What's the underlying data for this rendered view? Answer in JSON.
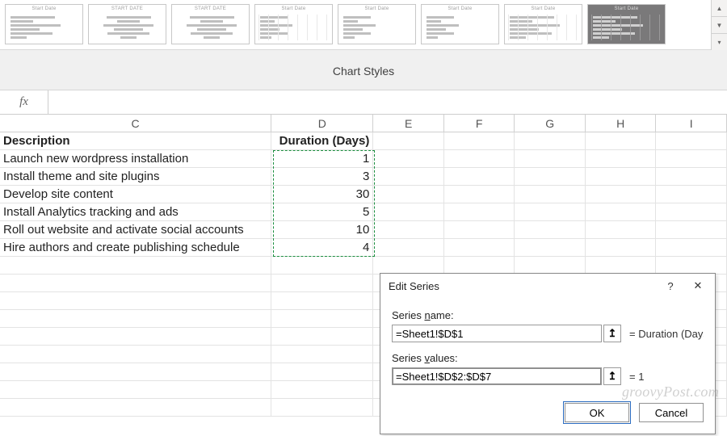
{
  "ribbon": {
    "section_label": "Chart Styles",
    "items": [
      {
        "title": "Start Date",
        "variant": "plain"
      },
      {
        "title": "START DATE",
        "variant": "centered"
      },
      {
        "title": "START DATE",
        "variant": "centered"
      },
      {
        "title": "Start Date",
        "variant": "short gridded"
      },
      {
        "title": "Start Date",
        "variant": "short"
      },
      {
        "title": "Start Date",
        "variant": "short"
      },
      {
        "title": "Start Date",
        "variant": "gridded"
      },
      {
        "title": "Start Date",
        "variant": "dark gridded"
      }
    ],
    "side_buttons": {
      "up": "▲",
      "down": "▼",
      "more": "▾"
    }
  },
  "formula_bar": {
    "fx_label": "fx",
    "value": ""
  },
  "grid": {
    "columns": [
      "C",
      "D",
      "E",
      "F",
      "G",
      "H",
      "I"
    ],
    "header_row": {
      "c": "Description",
      "d": "Duration (Days)"
    },
    "rows": [
      {
        "c": "Launch new wordpress installation",
        "d": "1"
      },
      {
        "c": "Install theme and site plugins",
        "d": "3"
      },
      {
        "c": "Develop site content",
        "d": "30"
      },
      {
        "c": "Install Analytics tracking and ads",
        "d": "5"
      },
      {
        "c": "Roll out website and activate social accounts",
        "d": "10"
      },
      {
        "c": "Hire authors and create publishing schedule",
        "d": "4"
      }
    ],
    "blank_rows": 9,
    "selection_note": "D2:D7 marquee"
  },
  "dialog": {
    "title": "Edit Series",
    "help": "?",
    "close": "✕",
    "labels": {
      "series_name": "Series name:",
      "series_values": "Series values:"
    },
    "series_name_value": "=Sheet1!$D$1",
    "series_name_preview": "= Duration (Days...",
    "series_values_value": "=Sheet1!$D$2:$D$7",
    "series_values_preview": "= 1",
    "ref_icon": "↥",
    "buttons": {
      "ok": "OK",
      "cancel": "Cancel"
    }
  },
  "watermark": "groovyPost.com",
  "chart_data": {
    "type": "bar",
    "title": "Duration (Days)",
    "categories": [
      "Launch new wordpress installation",
      "Install theme and site plugins",
      "Develop site content",
      "Install Analytics tracking and ads",
      "Roll out website and activate social accounts",
      "Hire authors and create publishing schedule"
    ],
    "values": [
      1,
      3,
      30,
      5,
      10,
      4
    ],
    "xlabel": "",
    "ylabel": "Duration (Days)",
    "ylim": [
      0,
      30
    ]
  }
}
